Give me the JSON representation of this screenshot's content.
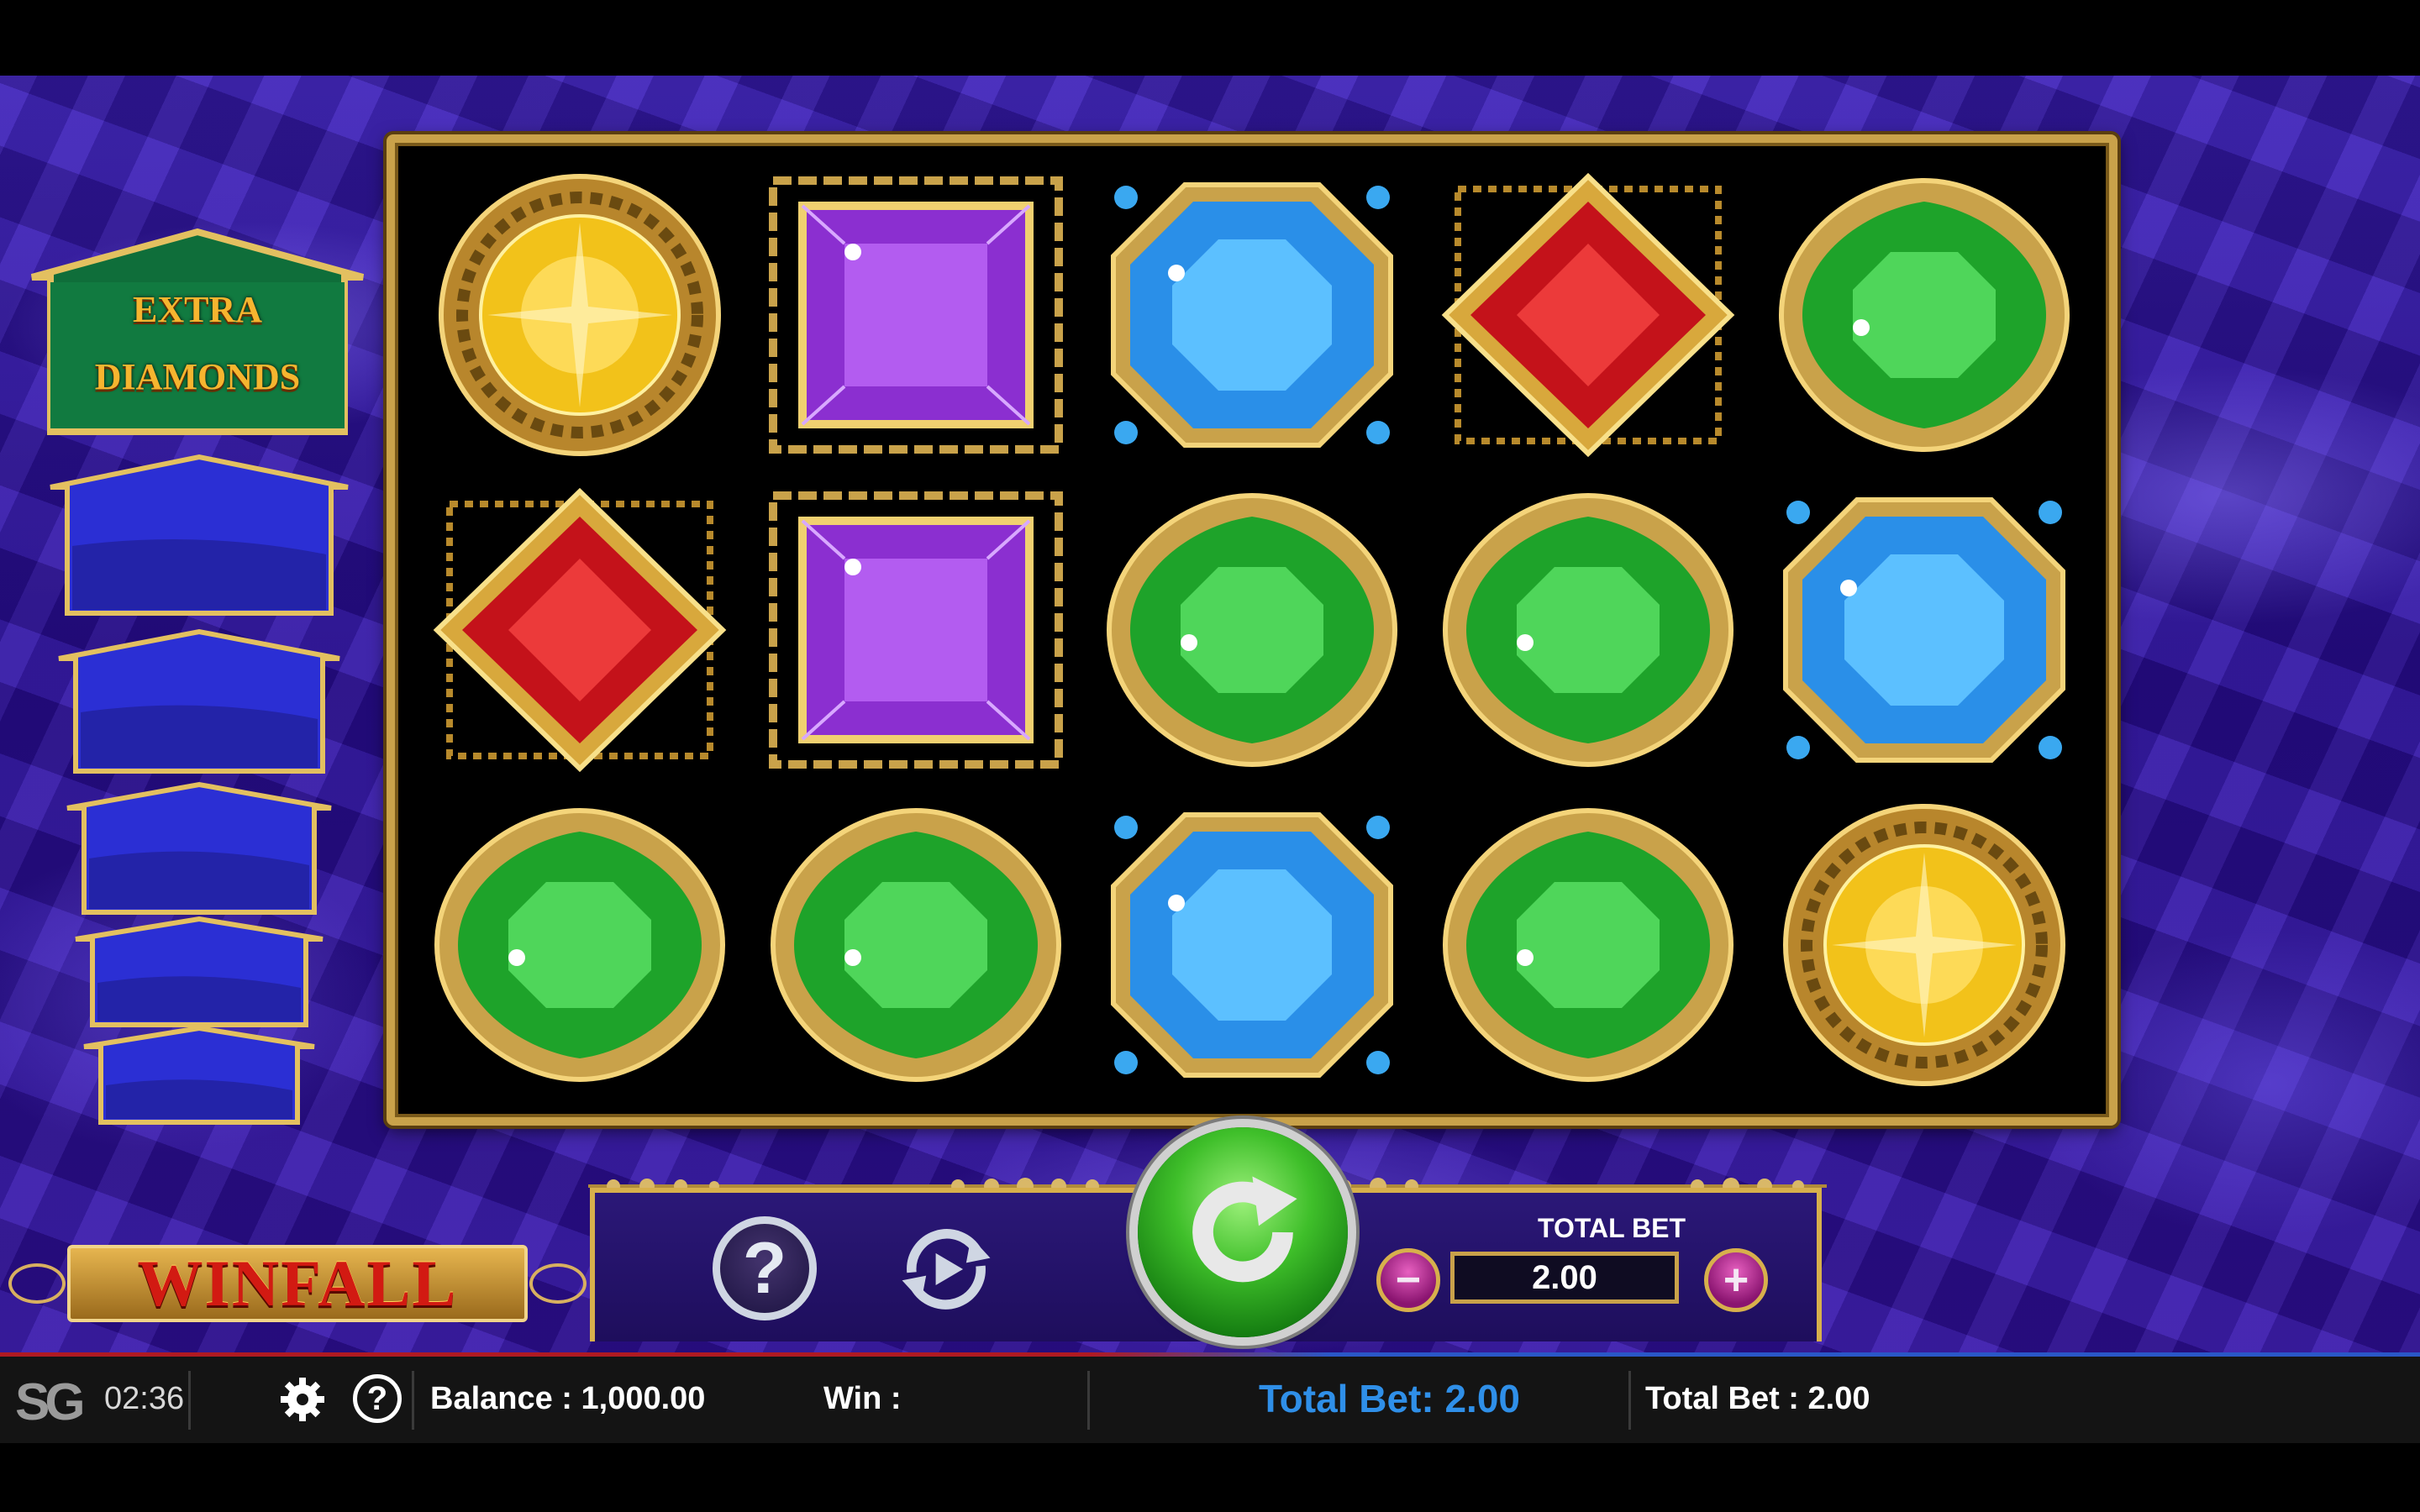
{
  "ladder": {
    "top_label_line1": "EXTRA",
    "top_label_line2": "DIAMONDS"
  },
  "reels": [
    [
      "yellow",
      "purple",
      "blue",
      "red",
      "green"
    ],
    [
      "red",
      "purple",
      "green",
      "green",
      "blue"
    ],
    [
      "green",
      "green",
      "blue",
      "green",
      "yellow"
    ]
  ],
  "logo": {
    "text": "WINFALL"
  },
  "panel": {
    "help_symbol": "?",
    "total_bet_label": "TOTAL BET",
    "total_bet_value": "2.00",
    "minus_symbol": "−",
    "plus_symbol": "+"
  },
  "bottom_bar": {
    "brand": "SG",
    "clock": "02:36",
    "help_symbol": "?",
    "balance": "Balance : 1,000.00",
    "win": "Win :",
    "total_bet_center": "Total Bet: 2.00",
    "total_bet_right": "Total Bet : 2.00"
  },
  "colors": {
    "gold": "#c9a24a",
    "spin_green": "#3fbf2a",
    "total_bet_blue": "#2f8fe8",
    "background_purple": "#2a0f95"
  }
}
